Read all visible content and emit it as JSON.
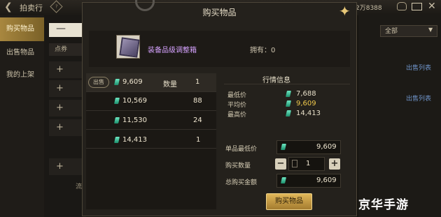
{
  "topbar": {
    "back_icon": "back-arrow-icon",
    "title": "拍卖行",
    "help_icon": "help-diamond-icon",
    "currency_text": "2万8388",
    "close_symbol": "✕"
  },
  "sidebar": {
    "tabs": [
      {
        "label": "购买物品",
        "active": true
      },
      {
        "label": "出售物品",
        "active": false
      },
      {
        "label": "我的上架",
        "active": false
      }
    ]
  },
  "background_list": {
    "filter_value": "—",
    "header_label": "点券",
    "plus_symbol": "+",
    "footer_fragment": "流"
  },
  "right_panel": {
    "filter_label": "全部",
    "sell_list_link_1": "出售列表",
    "sell_list_link_2": "出售列表"
  },
  "modal": {
    "title": "购买物品",
    "item_name": "装备品级调整箱",
    "owned_label": "拥有：0",
    "order_list": {
      "sell_tag": "出售",
      "qty_header": "数量",
      "rows": [
        {
          "price": "9,609",
          "qty": "1"
        },
        {
          "price": "10,569",
          "qty": "88"
        },
        {
          "price": "11,530",
          "qty": "24"
        },
        {
          "price": "14,413",
          "qty": "1"
        }
      ]
    },
    "market": {
      "title": "行情信息",
      "rows": [
        {
          "label": "最低价",
          "value": "7,688",
          "color": "#e6dec8"
        },
        {
          "label": "平均价",
          "value": "9,609",
          "color": "#f0c94c"
        },
        {
          "label": "最高价",
          "value": "14,413",
          "color": "#e6dec8"
        }
      ]
    },
    "form": {
      "unit_price_label": "单品最低价",
      "unit_price_value": "9,609",
      "qty_label": "购买数量",
      "qty_value": "1",
      "minus": "−",
      "plus": "+",
      "total_label": "总购买金额",
      "total_value": "9,609"
    },
    "buy_button": "购买物品"
  },
  "watermark": "京华手游"
}
